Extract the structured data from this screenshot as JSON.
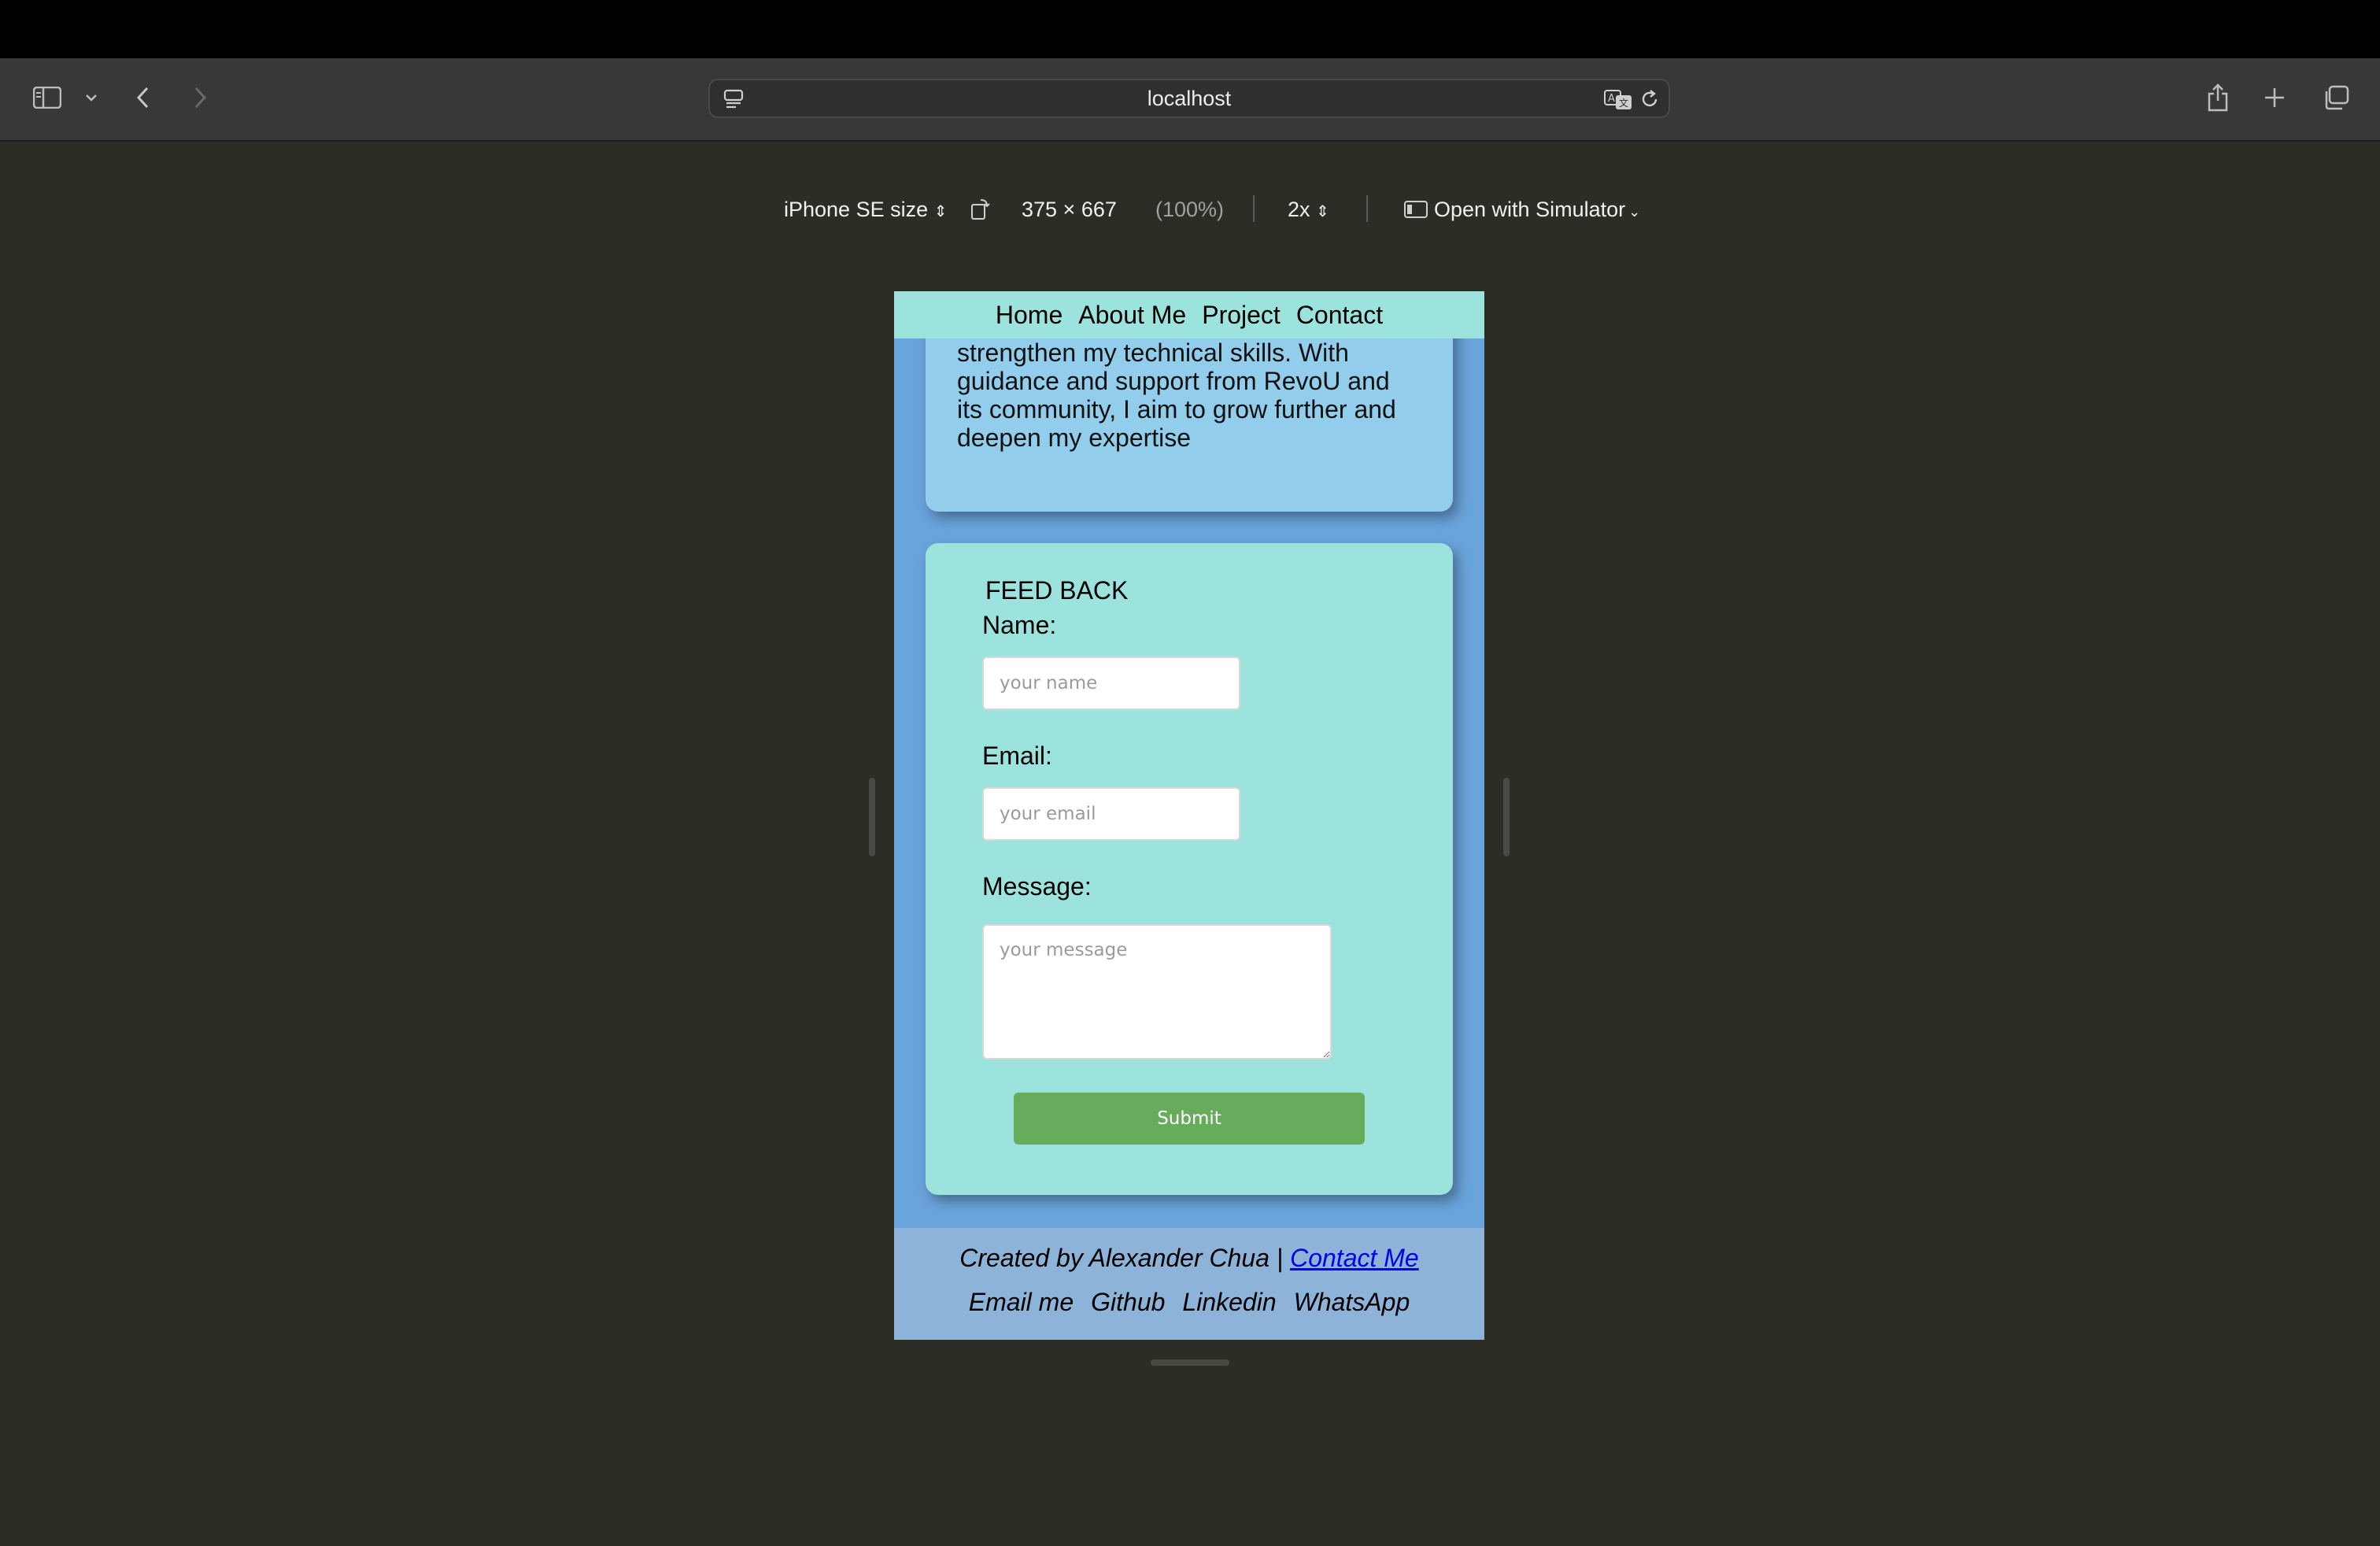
{
  "browser": {
    "url": "localhost"
  },
  "responsive_bar": {
    "device": "iPhone SE size",
    "dimensions": "375 × 667",
    "zoom": "(100%)",
    "scale": "2x",
    "open_with": "Open with Simulator"
  },
  "nav": {
    "items": [
      "Home",
      "About Me",
      "Project",
      "Contact"
    ]
  },
  "about": {
    "text": "strengthen my technical skills. With guidance and support from RevoU and its community, I aim to grow further and deepen my expertise"
  },
  "feedback": {
    "title": "FEED BACK",
    "name_label": "Name:",
    "name_placeholder": "your name",
    "email_label": "Email:",
    "email_placeholder": "your email",
    "message_label": "Message:",
    "message_placeholder": "your message",
    "submit_label": "Submit"
  },
  "footer": {
    "created_by": "Created by Alexander Chua | ",
    "contact_link": "Contact Me",
    "links": [
      "Email me",
      "Github",
      "Linkedin",
      "WhatsApp"
    ]
  },
  "colors": {
    "nav_bg": "#9ce2dd",
    "page_bg": "#6aa4dc",
    "about_card": "#93cdec",
    "feedback_card": "#9ce3dd",
    "submit_button": "#67ac5c",
    "footer_bg": "#8db3d8"
  }
}
